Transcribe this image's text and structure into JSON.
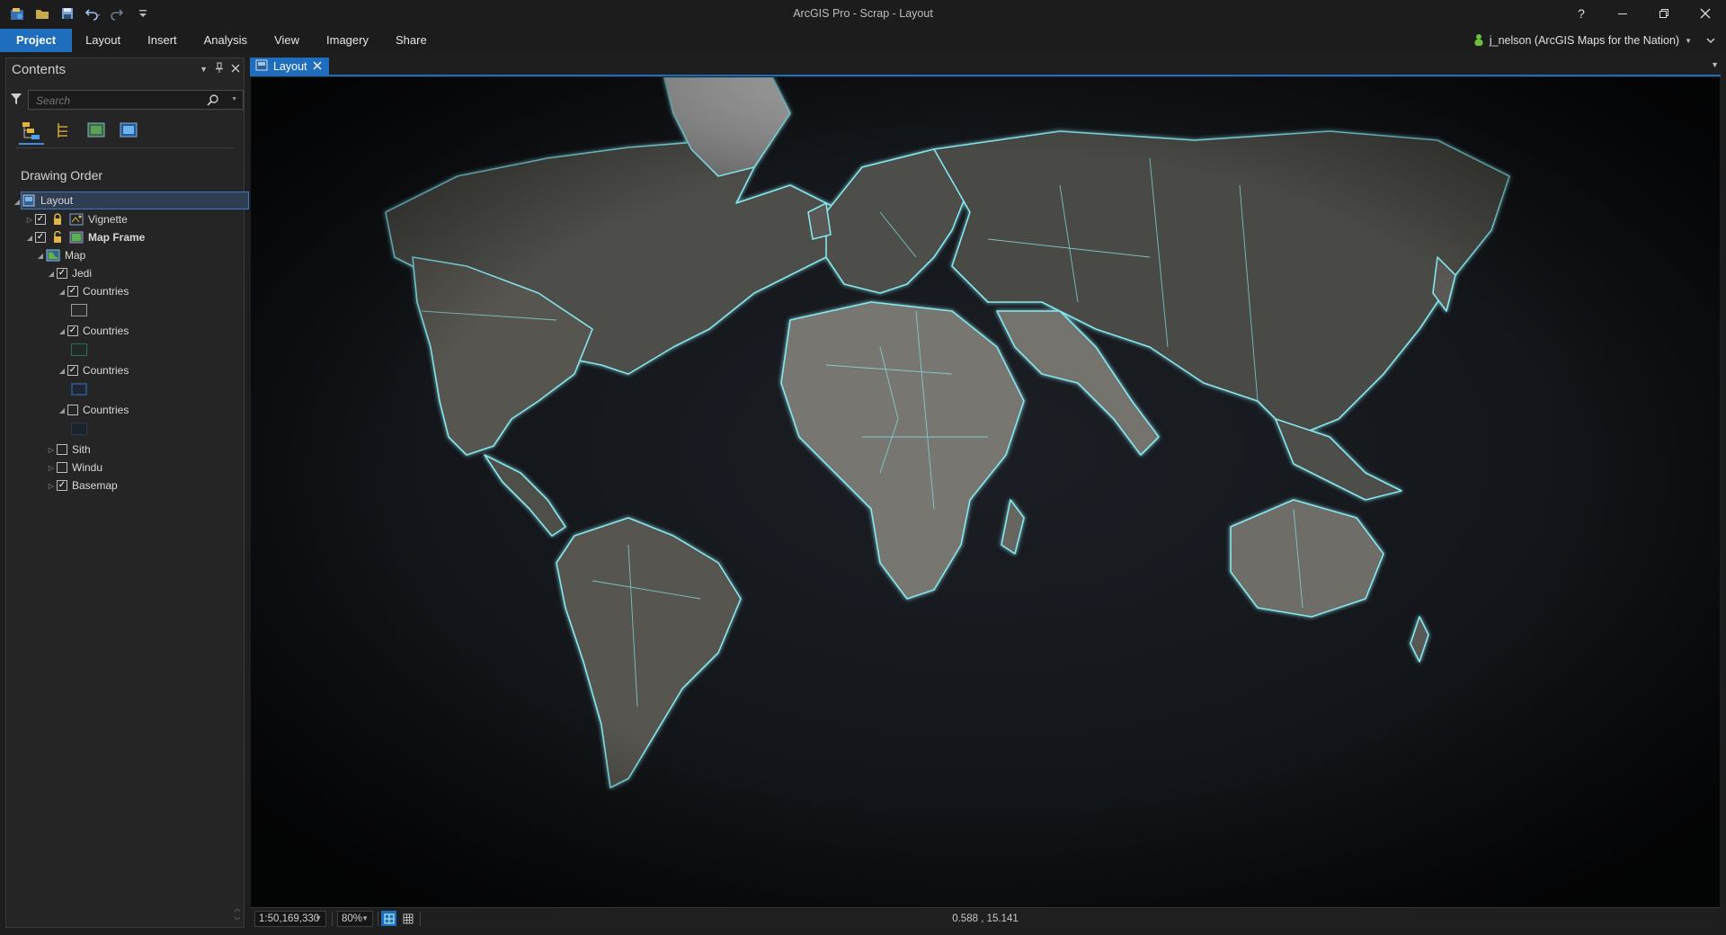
{
  "window": {
    "title": "ArcGIS Pro - Scrap - Layout"
  },
  "quick_access": {
    "icons": [
      "project-icon",
      "open-icon",
      "save-icon",
      "undo-icon",
      "redo-icon",
      "customize-icon"
    ]
  },
  "window_controls": {
    "help": "?"
  },
  "ribbon": {
    "tabs": [
      {
        "label": "Project",
        "active": true
      },
      {
        "label": "Layout"
      },
      {
        "label": "Insert"
      },
      {
        "label": "Analysis"
      },
      {
        "label": "View"
      },
      {
        "label": "Imagery"
      },
      {
        "label": "Share"
      }
    ]
  },
  "user": {
    "name": "j_nelson (ArcGIS Maps for the Nation)"
  },
  "contents": {
    "title": "Contents",
    "search_placeholder": "Search",
    "section": "Drawing Order",
    "items": [
      {
        "label": "Layout"
      },
      {
        "label": "Vignette"
      },
      {
        "label": "Map Frame"
      },
      {
        "label": "Map"
      },
      {
        "label": "Jedi"
      },
      {
        "label": "Countries"
      },
      {
        "label": "Countries"
      },
      {
        "label": "Countries"
      },
      {
        "label": "Countries"
      },
      {
        "label": "Sith"
      },
      {
        "label": "Windu"
      },
      {
        "label": "Basemap"
      }
    ]
  },
  "document": {
    "tab_label": "Layout"
  },
  "statusbar": {
    "scale": "1:50,169,330",
    "zoom": "80%",
    "coordinates": "0.588 , 15.141"
  },
  "colors": {
    "accent": "#1f6dbd",
    "outline": "#7fe4ec",
    "land": "#6d6c68",
    "ocean": "#14171c"
  }
}
